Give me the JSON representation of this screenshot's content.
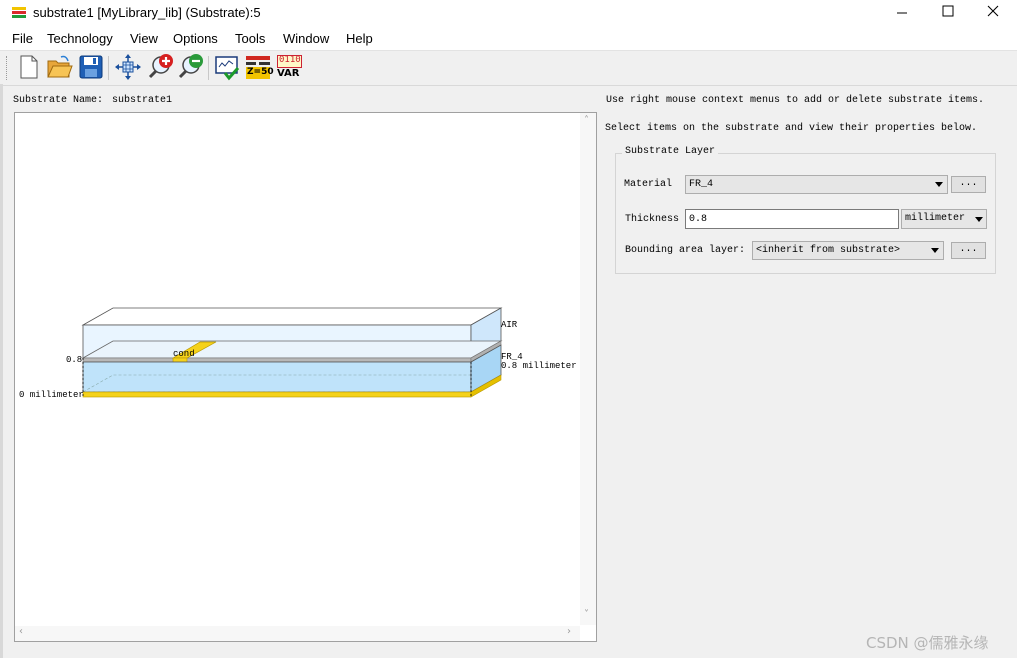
{
  "window": {
    "title": "substrate1 [MyLibrary_lib] (Substrate):5"
  },
  "menu": [
    "File",
    "Technology",
    "View",
    "Options",
    "Tools",
    "Window",
    "Help"
  ],
  "toolbar_icons": [
    "new-file-icon",
    "open-folder-icon",
    "save-icon",
    "pan-icon",
    "zoom-in-icon",
    "zoom-out-icon",
    "check-icon",
    "impedance-z50-icon",
    "var-icon"
  ],
  "toolbar_text": {
    "z50": "Z=50",
    "binary": "0110",
    "var": "VAR"
  },
  "substrate": {
    "name_label": "Substrate Name:",
    "name": "substrate1"
  },
  "diagram": {
    "air_label": "AIR",
    "cond_label": "cond",
    "fr4_label": "FR_4",
    "fr4_thickness_label": "0.8 millimeter",
    "left_thickness_label": "0.8",
    "bottom_label": "0 millimeter"
  },
  "hints": {
    "line1": "Use right mouse context menus to add or delete substrate items.",
    "line2": "Select items on the substrate and view their properties below."
  },
  "layer_panel": {
    "title": "Substrate Layer",
    "material_label": "Material",
    "material_value": "FR_4",
    "thickness_label": "Thickness",
    "thickness_value": "0.8",
    "unit_value": "millimeter",
    "bounding_label": "Bounding area layer:",
    "bounding_value": "<inherit from substrate>",
    "dots": "..."
  },
  "watermark": "CSDN @儒雅永缘",
  "colors": {
    "substrate": "#bfe3fa",
    "conductor": "#f5d21a",
    "air": "#e6f4ff"
  }
}
